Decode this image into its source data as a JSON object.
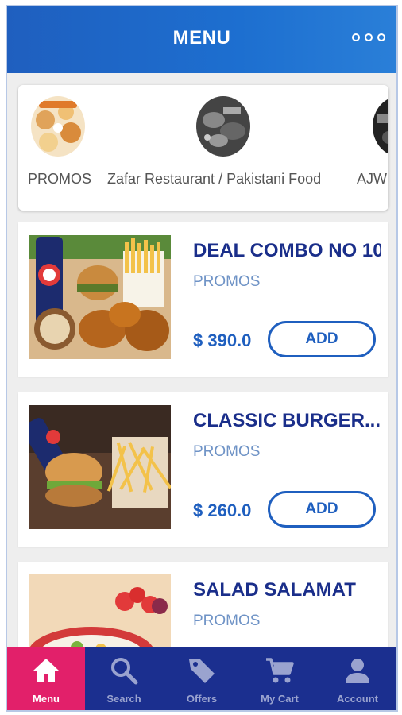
{
  "header": {
    "title": "MENU",
    "more_icon": "more-dots-icon"
  },
  "categories": [
    {
      "label": "PROMOS"
    },
    {
      "label": "Zafar Restaurant / Pakistani Food"
    },
    {
      "label": "AJW"
    }
  ],
  "menu_items": [
    {
      "name": "DEAL COMBO NO 10",
      "category": "PROMOS",
      "price": "$ 390.0",
      "add_label": "ADD"
    },
    {
      "name": "CLASSIC BURGER...",
      "category": "PROMOS",
      "price": "$ 260.0",
      "add_label": "ADD"
    },
    {
      "name": "SALAD SALAMAT",
      "category": "PROMOS",
      "price": "",
      "add_label": ""
    }
  ],
  "bottom_nav": [
    {
      "label": "Menu",
      "icon": "home-icon",
      "active": true
    },
    {
      "label": "Search",
      "icon": "search-icon",
      "active": false
    },
    {
      "label": "Offers",
      "icon": "tag-icon",
      "active": false
    },
    {
      "label": "My Cart",
      "icon": "cart-icon",
      "active": false
    },
    {
      "label": "Account",
      "icon": "account-icon",
      "active": false
    }
  ],
  "colors": {
    "header": "#1f5fbf",
    "bottom_nav": "#1b2f8f",
    "active_tab": "#e2206a",
    "item_title": "#1a2e8a",
    "accent": "#1f5fbf"
  }
}
